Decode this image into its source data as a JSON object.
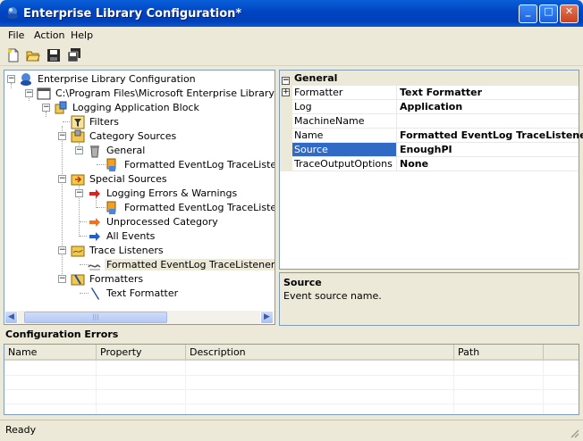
{
  "window": {
    "title": "Enterprise Library Configuration*"
  },
  "menu": [
    "File",
    "Action",
    "Help"
  ],
  "toolbar_icons": [
    "new-icon",
    "open-icon",
    "save-icon",
    "save-all-icon"
  ],
  "tree": {
    "root": "Enterprise Library Configuration",
    "app": "C:\\Program Files\\Microsoft Enterprise Library\\labs\\c",
    "block": "Logging Application Block",
    "filters": "Filters",
    "category_sources": "Category Sources",
    "general": "General",
    "general_listener": "Formatted EventLog TraceListener",
    "special_sources": "Special Sources",
    "logging_errors": "Logging Errors & Warnings",
    "errors_listener": "Formatted EventLog TraceListener",
    "unprocessed": "Unprocessed Category",
    "all_events": "All Events",
    "trace_listeners": "Trace Listeners",
    "selected_listener": "Formatted EventLog TraceListener",
    "formatters": "Formatters",
    "text_formatter": "Text Formatter"
  },
  "propgrid": {
    "category": "General",
    "rows": [
      {
        "name": "Formatter",
        "value": "Text Formatter",
        "expandable": true
      },
      {
        "name": "Log",
        "value": "Application"
      },
      {
        "name": "MachineName",
        "value": ""
      },
      {
        "name": "Name",
        "value": "Formatted EventLog TraceListener"
      },
      {
        "name": "Source",
        "value": "EnoughPI",
        "selected": true
      },
      {
        "name": "TraceOutputOptions",
        "value": "None"
      }
    ],
    "expand_glyph": "+",
    "collapse_glyph": "−"
  },
  "description": {
    "title": "Source",
    "text": "Event source name."
  },
  "errors": {
    "label": "Configuration Errors",
    "columns": [
      "Name",
      "Property",
      "Description",
      "Path"
    ]
  },
  "status": {
    "text": "Ready"
  },
  "scroll_glyphs": {
    "left": "◀",
    "right": "▶",
    "thumb": "|||"
  },
  "caption_glyphs": {
    "minimize": "_",
    "maximize": "□",
    "close": "✕"
  },
  "colors": {
    "titlebar": "#0044c2",
    "selection": "#316ac5",
    "chrome": "#ece9d8"
  }
}
